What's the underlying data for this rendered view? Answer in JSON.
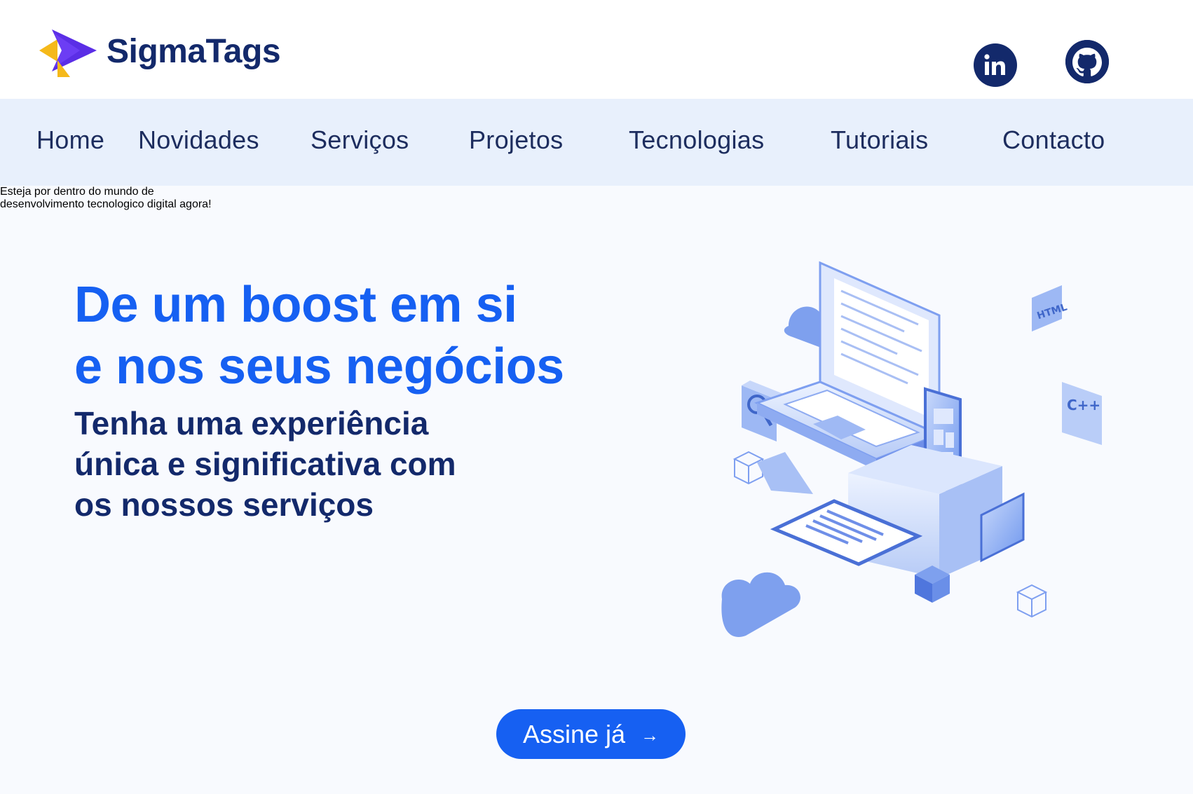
{
  "header": {
    "brand_name": "SigmaTags",
    "logo_icon": "sigma-chevron-logo",
    "social": [
      {
        "name": "linkedin-icon",
        "label": "in"
      },
      {
        "name": "github-icon"
      }
    ]
  },
  "nav": {
    "items": [
      {
        "label": "Home"
      },
      {
        "label": "Novidades"
      },
      {
        "label": "Serviços"
      },
      {
        "label": "Projetos"
      },
      {
        "label": "Tecnologias"
      },
      {
        "label": "Tutoriais"
      },
      {
        "label": "Contacto"
      }
    ]
  },
  "hero": {
    "headline_lines": [
      "De um boost em si",
      "e nos seus negócios"
    ],
    "subhead_lines": [
      "Tenha uma experiência",
      "única e significativa com",
      "os nossos serviços"
    ],
    "description_lines": [
      "Esteja por dentro do mundo de",
      "desenvolvimento tecnologico digital agora!"
    ],
    "cta_label": "Assine já",
    "cta_arrow": "→",
    "illustration": {
      "icon": "isometric-tech-illustration",
      "badges": [
        "HTML",
        "C++"
      ]
    }
  },
  "colors": {
    "brand_navy": "#13296b",
    "accent_blue": "#1660f2",
    "nav_bg": "#e8f0fc",
    "hero_bg": "#f8fafe",
    "muted_text": "#5f72a3",
    "logo_yellow": "#f5b91a",
    "logo_purple": "#5b2ee6"
  }
}
